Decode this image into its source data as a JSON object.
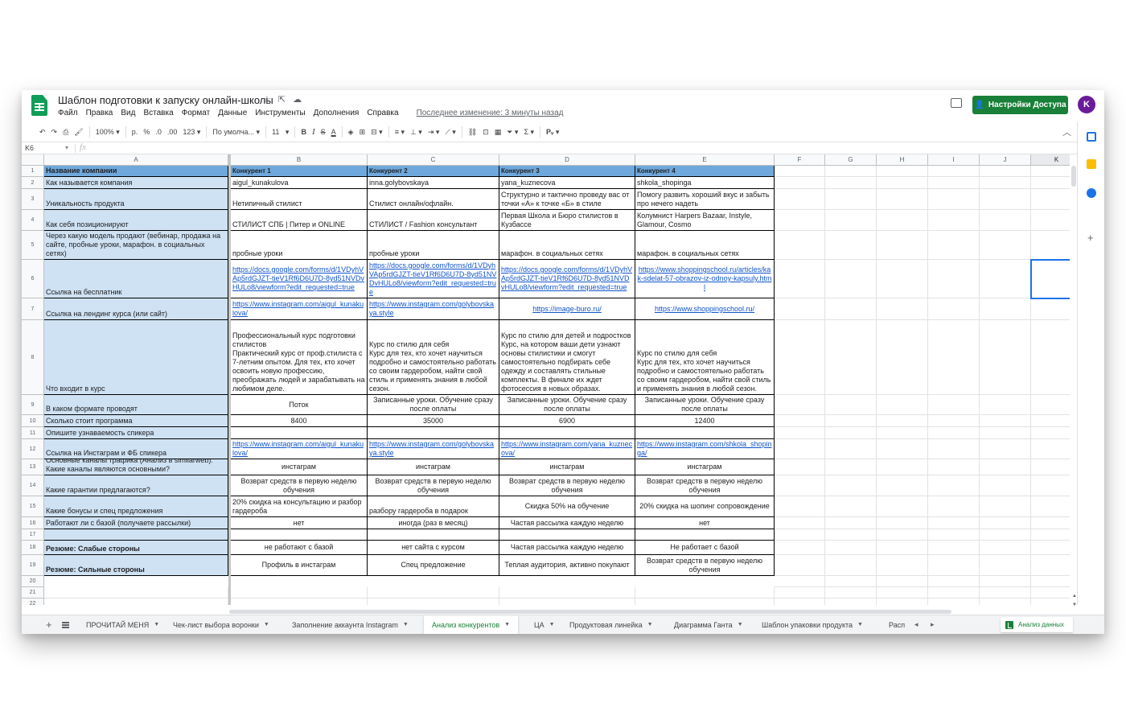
{
  "app": {
    "doc_title": "Шаблон подготовки к запуску онлайн-школы",
    "last_edit": "Последнее изменение: 3 минуты назад",
    "share_label": "Настройки Доступа",
    "avatar_initial": "K",
    "brand_color": "#188038"
  },
  "menu": [
    "Файл",
    "Правка",
    "Вид",
    "Вставка",
    "Формат",
    "Данные",
    "Инструменты",
    "Дополнения",
    "Справка"
  ],
  "toolbar": {
    "zoom": "100%",
    "currency": "р.",
    "percent": "%",
    "dec_less": ".0",
    "dec_more": ".00",
    "format_more": "123",
    "font": "По умолча...",
    "font_size": "11",
    "bold": "B",
    "italic": "I",
    "strike": "S",
    "text_color": "A",
    "sigma": "Σ"
  },
  "formula_bar": {
    "cell_ref": "K6",
    "fx": "fx"
  },
  "columns": [
    "A",
    "B",
    "C",
    "D",
    "E",
    "F",
    "G",
    "H",
    "I",
    "J",
    "K"
  ],
  "row_numbers": [
    "1",
    "2",
    "3",
    "4",
    "5",
    "6",
    "7",
    "8",
    "9",
    "10",
    "11",
    "12",
    "13",
    "14",
    "15",
    "16",
    "17",
    "18",
    "19",
    "20",
    "21",
    "22"
  ],
  "table": {
    "header_label": "Название компании",
    "competitors": [
      "Конкурент 1",
      "Конкурент 2",
      "Конкурент 3",
      "Конкурент 4"
    ],
    "rows": [
      {
        "label": "Как называется компания",
        "values": [
          "aigul_kunakulova",
          "inna.golybovskaya",
          "yana_kuznecova",
          "shkola_shopinga"
        ]
      },
      {
        "label": "Уникальность продукта",
        "values": [
          "Нетипичный стилист",
          "Стилист онлайн/офлайн.",
          "Структурно и тактично проведу вас от точки «А» к точке «Б» в стиле",
          "Помогу развить хороший вкус и забыть про нечего надеть"
        ]
      },
      {
        "label": "Как себя позиционируют",
        "values": [
          "СТИЛИСТ СПБ | Питер и ONLINE",
          "СТИЛИСТ / Fashion консультант",
          "Первая Школа и Бюро стилистов в Кузбассе",
          "Колумнист Harpers Bazaar, Instyle, Glamour, Cosmo"
        ]
      },
      {
        "label": "Через какую модель продают (вебинар, продажа на сайте, пробные уроки, марафон. в социальных сетях)",
        "values": [
          "пробные уроки",
          "пробные уроки",
          "марафон. в социальных сетях",
          "марафон. в социальных сетях"
        ]
      },
      {
        "label": "Ссылка на бесплатник",
        "values": [
          "https://docs.google.com/forms/d/1VDyhVAp5rdGJZT-tieV1Rf6D6U7D-8yd51NVDvHULo8/viewform?edit_requested=true",
          "https://docs.google.com/forms/d/1VDyhVAp5rdGJZT-tieV1Rf6D6U7D-8yd51NVDvHULo8/viewform?edit_requested=true",
          "https://docs.google.com/forms/d/1VDyhVAp5rdGJZT-tieV1Rf6D6U7D-8yd51NVDvHULo8/viewform?edit_requested=true",
          "https://www.shoppingschool.ru/articles/kak-sdelat-57-obrazov-iz-odnoy-kapsuly.html"
        ]
      },
      {
        "label": "Ссылка на лендинг курса (или сайт)",
        "values": [
          "https://www.instagram.com/aigul_kunakulova/",
          "https://www.instagram.com/golybovskaya.style",
          "https://image-buro.ru/",
          "https://www.shoppingschool.ru/"
        ]
      },
      {
        "label": "Что входит в курс",
        "values": [
          "Профессиональный курс подготовки стилистов\nПрактический курс от проф.стилиста с 7-летним опытом. Для тех, кто хочет освоить новую профессию, преображать людей и зарабатывать на любимом деле.",
          "Курс по стилю для себя\nКурс для тех, кто хочет научиться подробно и самостоятельно работать со своим гардеробом, найти свой стиль и применять знания в любой сезон.",
          "Курс по стилю для детей и подростков\nКурс, на котором ваши дети узнают основы стилистики и смогут самостоятельно подбирать себе одежду и составлять стильные комплекты. В финале их ждет фотосессия в новых образах.",
          "Курс по стилю для себя\nКурс для тех, кто хочет научиться подробно и самостоятельно работать со своим гардеробом, найти свой стиль и применять знания в любой сезон."
        ]
      },
      {
        "label": "В каком формате проводят",
        "values": [
          "Поток",
          "Записанные уроки. Обучение сразу после оплаты",
          "Записанные уроки. Обучение сразу после оплаты",
          "Записанные уроки. Обучение сразу после оплаты"
        ]
      },
      {
        "label": "Сколько стоит программа",
        "values": [
          "8400",
          "35000",
          "6900",
          "12400"
        ]
      },
      {
        "label": "Опишите узнаваемость спикера",
        "values": [
          "",
          "",
          "",
          ""
        ]
      },
      {
        "label": "Ссылка на Инстаграм и ФБ спикера",
        "values": [
          "https://www.instagram.com/aigul_kunakulova/",
          "https://www.instagram.com/golybovskaya.style",
          "https://www.instagram.com/yana_kuznecova/",
          "https://www.instagram.com/shkola_shopinga/"
        ]
      },
      {
        "label": "Основные каналы трафика (Анализ в similarweb): Какие каналы являются основными?",
        "values": [
          "инстаграм",
          "инстаграм",
          "инстаграм",
          "инстаграм"
        ]
      },
      {
        "label": "Какие гарантии предлагаются?",
        "values": [
          "Возврат средств в первую неделю обучения",
          "Возврат средств в первую неделю обучения",
          "Возврат средств в первую неделю обучения",
          "Возврат средств в первую неделю обучения"
        ]
      },
      {
        "label": "Какие бонусы и спец предложения",
        "values": [
          "20% скидка на консультацию и разбор гардероба",
          "разбору гардероба в подарок",
          "Скидка 50% на обучение",
          "20% скидка на шопинг сопровождение"
        ]
      },
      {
        "label": "Работают ли с базой (получаете рассылки)",
        "values": [
          "нет",
          "иногда (раз в месяц)",
          "Частая рассылка каждую неделю",
          "нет"
        ]
      },
      {
        "label": "",
        "values": [
          "",
          "",
          "",
          ""
        ]
      },
      {
        "label": "Резюме: Слабые стороны",
        "values": [
          "не работают с базой",
          "нет сайта с курсом",
          "Частая рассылка каждую неделю",
          "Не работает с базой"
        ]
      },
      {
        "label": "Резюме: Сильные стороны",
        "values": [
          "Профиль в инстаграм",
          "Спец предложение",
          "Теплая аудитория, активно покупают",
          "Возврат средств в первую неделю обучения"
        ]
      }
    ]
  },
  "tabs": {
    "items": [
      {
        "label": "ПРОЧИТАЙ МЕНЯ"
      },
      {
        "label": "Чек-лист выбора воронки"
      },
      {
        "label": "Заполнение аккаунта Instagram"
      },
      {
        "label": "Анализ конкурентов"
      },
      {
        "label": "ЦА"
      },
      {
        "label": "Продуктовая линейка"
      },
      {
        "label": "Диаграмма Ганта"
      },
      {
        "label": "Шаблон упаковки продукта"
      },
      {
        "label": "Расп"
      }
    ],
    "explore_label": "Анализ данных"
  },
  "colors": {
    "label_fill": "#cfe2f3",
    "header_fill": "#6fa8dc",
    "link": "#1155cc",
    "selection": "#1a73e8"
  }
}
